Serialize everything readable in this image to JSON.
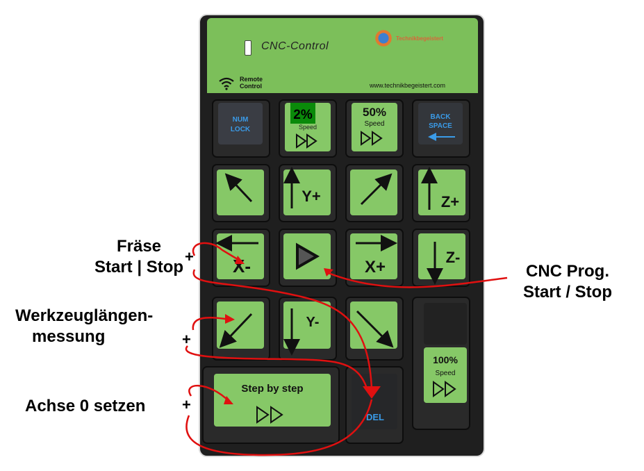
{
  "device": {
    "title": "CNC-Control",
    "remote_label_1": "Remote",
    "remote_label_2": "Control",
    "website": "www.technikbegeistert.com",
    "logo_text": "Technikbegeistert"
  },
  "keys": {
    "numlock_1": "NUM",
    "numlock_2": "LOCK",
    "speed2_pct": "2%",
    "speed_label": "Speed",
    "speed50_pct": "50%",
    "backspace_1": "BACK",
    "backspace_2": "SPACE",
    "y_plus": "Y+",
    "z_plus": "Z+",
    "x_minus": "X-",
    "x_plus": "X+",
    "z_minus": "Z-",
    "y_minus": "Y-",
    "speed100_pct": "100%",
    "step_by_step": "Step by step",
    "del": "DEL"
  },
  "annotations": {
    "fraese_1": "Fräse",
    "fraese_2": "Start | Stop",
    "werkzeug_1": "Werkzeuglängen-",
    "werkzeug_2": "messung",
    "achse": "Achse 0 setzen",
    "cnc_1": "CNC Prog.",
    "cnc_2": "Start / Stop",
    "plus": "+"
  },
  "colors": {
    "key_green": "#86c867",
    "panel_green": "#7cbf5a",
    "highlight_green": "#0a8a0a",
    "arrow_red": "#e01010",
    "blue_text": "#3a9be8"
  }
}
